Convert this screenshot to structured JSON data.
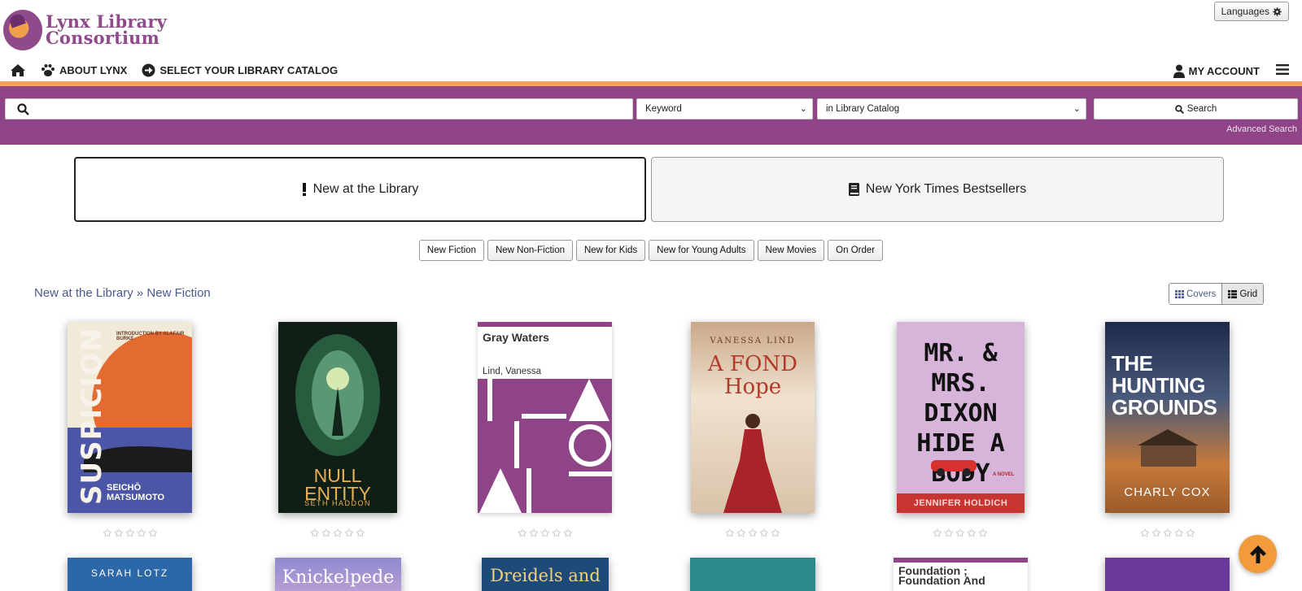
{
  "header": {
    "logo_line1": "Lynx Library",
    "logo_line2": "Consortium",
    "languages_label": "Languages"
  },
  "nav": {
    "about_label": "ABOUT LYNX",
    "select_catalog_label": "SELECT YOUR LIBRARY CATALOG",
    "my_account_label": "MY ACCOUNT"
  },
  "search": {
    "query": "",
    "type_selected": "Keyword",
    "scope_selected": "in Library Catalog",
    "button_label": "Search",
    "advanced_label": "Advanced Search"
  },
  "tabs": [
    {
      "label": "New at the Library",
      "icon": "exclamation-icon",
      "active": true
    },
    {
      "label": "New York Times Bestsellers",
      "icon": "book-icon",
      "active": false
    }
  ],
  "subtabs": [
    "New Fiction",
    "New Non-Fiction",
    "New for Kids",
    "New for Young Adults",
    "New Movies",
    "On Order"
  ],
  "breadcrumb": {
    "parent": "New at the Library",
    "separator": "»",
    "current": "New Fiction"
  },
  "view_toggle": {
    "covers_label": "Covers",
    "grid_label": "Grid"
  },
  "books_row1": [
    {
      "cover_text": "SUSPICION",
      "author_text": "SEICHŌ MATSUMOTO",
      "intro_text": "INTRODUCTION BY ALAFAIR BURKE"
    },
    {
      "cover_text": "NULL ENTITY",
      "author_text": "SETH HADDON"
    },
    {
      "title": "Gray Waters",
      "author": "Lind, Vanessa"
    },
    {
      "cover_text": "A FOND Hope",
      "author_text": "VANESSA LIND"
    },
    {
      "cover_text": "MR. & MRS. DIXON HIDE A BODY",
      "author_text": "JENNIFER HOLDICH",
      "tag_text": "A NOVEL"
    },
    {
      "cover_text": "THE HUNTING GROUNDS",
      "author_text": "CHARLY COX"
    }
  ],
  "books_row2": [
    {
      "cover_text": "SARAH LOTZ"
    },
    {
      "cover_text": "Knickelpede"
    },
    {
      "cover_text": "Dreidels and"
    },
    {
      "cover_text": ""
    },
    {
      "title": "Foundation ; Foundation And"
    },
    {
      "cover_text": ""
    }
  ],
  "ratings": [
    0,
    0,
    0,
    0,
    0,
    0
  ],
  "colors": {
    "brand_purple": "#8e4486",
    "accent_orange": "#f2a25a",
    "link_blue": "#4a5a8a"
  }
}
